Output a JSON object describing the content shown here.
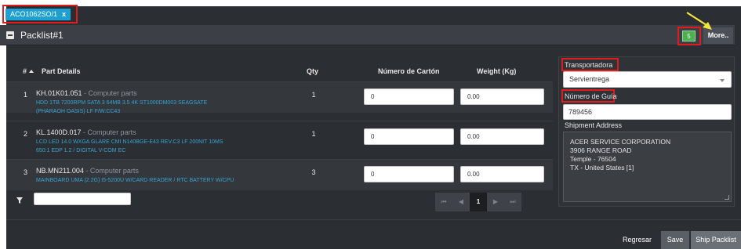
{
  "tab": {
    "label": "ACO1062SO/1",
    "close": "x"
  },
  "panel": {
    "title": "Packlist#1",
    "count": "5",
    "more_label": "More.."
  },
  "table": {
    "headers": {
      "num": "#",
      "part": "Part Details",
      "qty": "Qty",
      "carton": "Número de Cartón",
      "weight": "Weight (Kg)"
    },
    "rows": [
      {
        "num": "1",
        "part": "KH.01K01.051",
        "category": " - Computer parts",
        "desc1": "HDD 1TB 7200RPM SATA 3 64MB 3.5 4K ST1000DM003 SEAGSATE",
        "desc2": "(PHARAOH OASIS) LF F/W:CC43",
        "qty": "1",
        "carton": "0",
        "weight": "0.00"
      },
      {
        "num": "2",
        "part": "KL.1400D.017",
        "category": " - Computer parts",
        "desc1": "LCD LED 14.0 WXGA GLARE CMI N140BGE-E43 REV.C3 LF 200NIT 10MS",
        "desc2": "650:1 EDP 1.2 / DIGITAL V-COM EC",
        "qty": "1",
        "carton": "0",
        "weight": "0.00"
      },
      {
        "num": "3",
        "part": "NB.MN211.004",
        "category": " - Computer parts",
        "desc1": "MAINBOARD UMA (2.2G) I5-5200U W/CARD READER / RTC BATTERY W/CPU",
        "desc2": "",
        "qty": "3",
        "carton": "0",
        "weight": "0.00"
      }
    ]
  },
  "pager": {
    "first": "⏮",
    "prev": "◀",
    "current": "1",
    "next": "▶",
    "last": "⏭"
  },
  "shipping": {
    "carrier_label": "Transportadora",
    "carrier_value": "Servientrega",
    "guide_label": "Número de Guía",
    "guide_value": "789456",
    "address_label": "Shipment Address",
    "address_lines": [
      "ACER SERVICE CORPORATION",
      "3906 RANGE ROAD",
      "Temple - 76504",
      "TX - United States [1]"
    ]
  },
  "footer": {
    "back": "Regresar",
    "save": "Save",
    "ship": "Ship Packlist"
  },
  "colors": {
    "tab_accent": "#1fa0d3",
    "badge": "#4caf50",
    "highlight": "#e01c1c",
    "link_text": "#37a2d2"
  }
}
